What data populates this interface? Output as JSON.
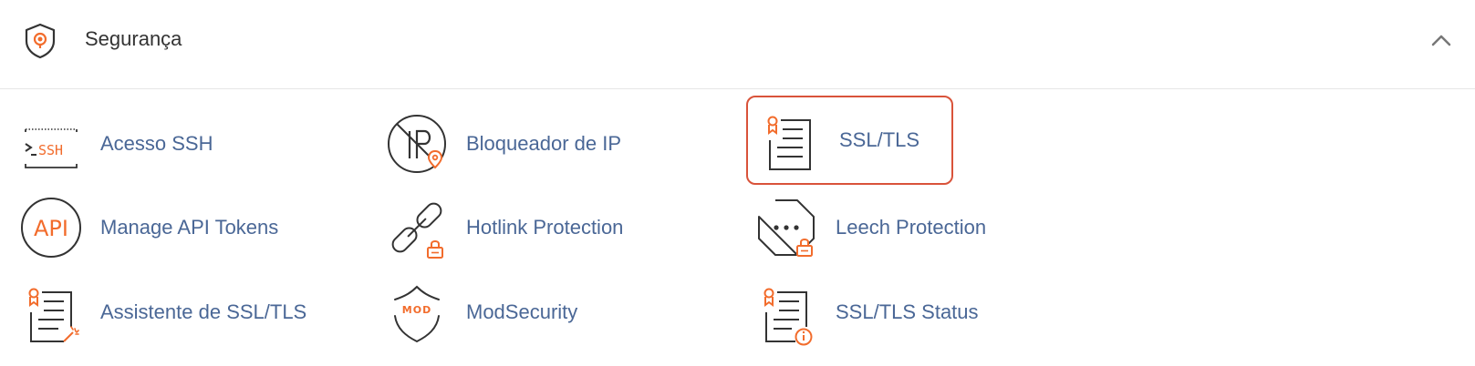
{
  "section": {
    "title": "Segurança",
    "icon": "shield-pin-icon",
    "expanded": true
  },
  "items": [
    {
      "label": "Acesso SSH",
      "icon": "ssh-terminal-icon",
      "highlighted": false
    },
    {
      "label": "Bloqueador de IP",
      "icon": "ip-blocker-icon",
      "highlighted": false
    },
    {
      "label": "SSL/TLS",
      "icon": "certificate-icon",
      "highlighted": true
    },
    {
      "label": "Manage API Tokens",
      "icon": "api-icon",
      "highlighted": false
    },
    {
      "label": "Hotlink Protection",
      "icon": "link-lock-icon",
      "highlighted": false
    },
    {
      "label": "Leech Protection",
      "icon": "leech-lock-icon",
      "highlighted": false
    },
    {
      "label": "Assistente de SSL/TLS",
      "icon": "certificate-wizard-icon",
      "highlighted": false
    },
    {
      "label": "ModSecurity",
      "icon": "modsecurity-shield-icon",
      "highlighted": false
    },
    {
      "label": "SSL/TLS Status",
      "icon": "certificate-status-icon",
      "highlighted": false
    }
  ],
  "colors": {
    "accent": "#f26c2c",
    "icon_stroke": "#333333",
    "link": "#4a6796",
    "highlight_border": "#d9533a"
  }
}
